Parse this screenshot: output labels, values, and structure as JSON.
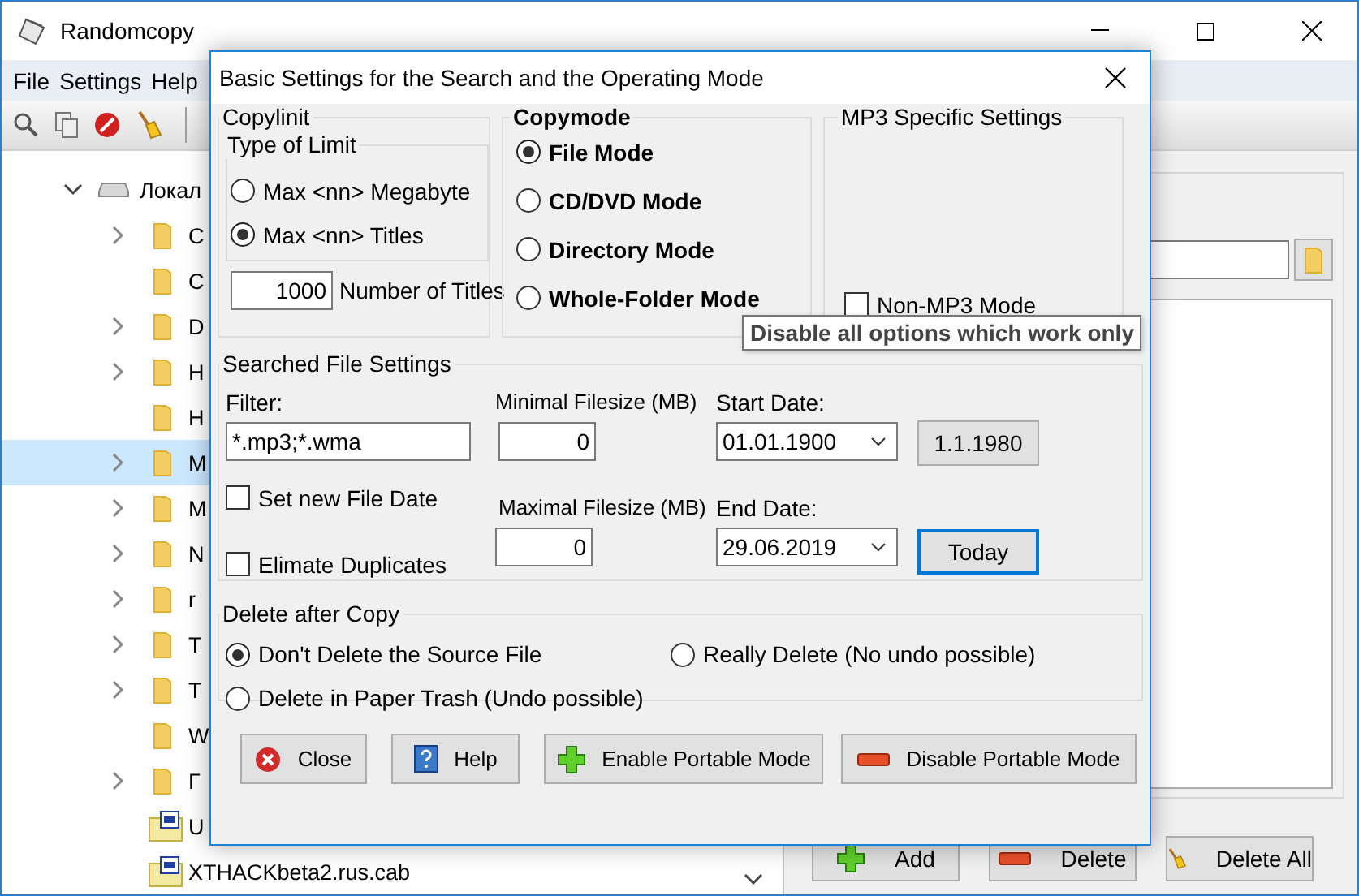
{
  "window": {
    "title": "Randomcopy"
  },
  "menu": [
    {
      "label": "File"
    },
    {
      "label": "Settings"
    },
    {
      "label": "Help"
    }
  ],
  "tree": [
    {
      "label": "Локал",
      "kind": "drive",
      "expanded": true,
      "selected": false,
      "children": [
        {
          "label": "C",
          "kind": "folder",
          "expanded": false,
          "selected": false
        },
        {
          "label": "C",
          "kind": "empty-folder",
          "selected": false
        },
        {
          "label": "D",
          "kind": "folder",
          "expanded": false,
          "selected": false
        },
        {
          "label": "H",
          "kind": "folder",
          "expanded": false,
          "selected": false
        },
        {
          "label": "H",
          "kind": "empty-folder",
          "selected": false
        },
        {
          "label": "M",
          "kind": "folder",
          "expanded": false,
          "selected": true
        },
        {
          "label": "M",
          "kind": "folder",
          "expanded": false,
          "selected": false
        },
        {
          "label": "N",
          "kind": "folder",
          "expanded": false,
          "selected": false
        },
        {
          "label": "r",
          "kind": "folder",
          "expanded": false,
          "selected": false
        },
        {
          "label": "T",
          "kind": "folder",
          "expanded": false,
          "selected": false
        },
        {
          "label": "T",
          "kind": "folder",
          "expanded": false,
          "selected": false
        },
        {
          "label": "W",
          "kind": "empty-folder",
          "selected": false
        },
        {
          "label": "Г",
          "kind": "folder",
          "expanded": false,
          "selected": false
        },
        {
          "label": "U",
          "kind": "file",
          "selected": false
        },
        {
          "label": "XTHACKbeta2.rus.cab",
          "kind": "file",
          "selected": false
        }
      ]
    }
  ],
  "list_buttons": [
    {
      "label": "Add",
      "kind": "plus"
    },
    {
      "label": "Delete",
      "kind": "minus"
    },
    {
      "label": "Delete All",
      "kind": "broom"
    }
  ],
  "dialog": {
    "title": "Basic Settings for the Search and the Operating Mode",
    "copylimit": {
      "title": "Copylinit",
      "type_title": "Type of Limit",
      "options": [
        {
          "label": "Max <nn> Megabyte",
          "selected": false
        },
        {
          "label": "Max <nn> Titles",
          "selected": true
        }
      ],
      "count": "1000",
      "count_label": "Number of Titles"
    },
    "copymode": {
      "title": "Copymode",
      "options": [
        {
          "label": "File Mode",
          "selected": true
        },
        {
          "label": "CD/DVD Mode",
          "selected": false
        },
        {
          "label": "Directory Mode",
          "selected": false
        },
        {
          "label": "Whole-Folder Mode",
          "selected": false
        }
      ]
    },
    "mp3": {
      "title": "MP3 Specific Settings",
      "option": {
        "label": "Non-MP3 Mode",
        "checked": false
      }
    },
    "search": {
      "title": "Searched File Settings",
      "filter_label": "Filter:",
      "filter": "*.mp3;*.wma",
      "checks": [
        {
          "label": "Set new File Date",
          "checked": false
        },
        {
          "label": "Elimate Duplicates",
          "checked": false
        }
      ],
      "min_label": "Minimal Filesize (MB)",
      "min": "0",
      "max_label": "Maximal Filesize (MB)",
      "max": "0",
      "start_label": "Start Date:",
      "start": "01.01.1900",
      "start_button": {
        "label": "1.1.1980",
        "focused": false
      },
      "end_label": "End Date:",
      "end": "29.06.2019",
      "end_button": {
        "label": "Today",
        "focused": true
      }
    },
    "delete": {
      "title": "Delete after Copy",
      "options": [
        {
          "label": "Don't Delete the Source File",
          "selected": true
        },
        {
          "label": "Really Delete (No undo possible)",
          "selected": false
        },
        {
          "label": "Delete in Paper Trash (Undo possible)",
          "selected": false
        }
      ]
    },
    "buttons": [
      {
        "label": "Close",
        "kind": "close"
      },
      {
        "label": "Help",
        "kind": "help"
      },
      {
        "label": "Enable Portable Mode",
        "kind": "plus"
      },
      {
        "label": "Disable Portable Mode",
        "kind": "minus"
      }
    ]
  },
  "tooltip": "Disable all options which work only"
}
